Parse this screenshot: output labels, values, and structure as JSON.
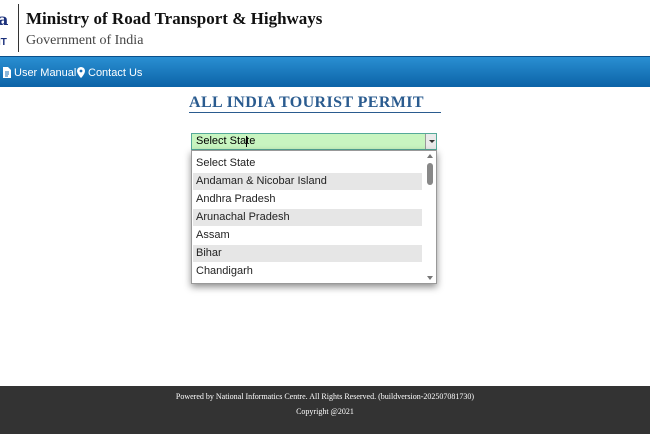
{
  "header": {
    "logo_text_top": "a",
    "logo_text_bottom": "IT",
    "title": "Ministry of Road Transport & Highways",
    "subtitle": "Government of India"
  },
  "nav": {
    "items": [
      {
        "label": "User Manual",
        "icon": "document-icon"
      },
      {
        "label": "Contact Us",
        "icon": "map-pin-icon"
      }
    ]
  },
  "main": {
    "heading": "ALL INDIA TOURIST PERMIT",
    "state_select": {
      "value": "Select State",
      "options": [
        "Select State",
        "Andaman & Nicobar Island",
        "Andhra Pradesh",
        "Arunachal Pradesh",
        "Assam",
        "Bihar",
        "Chandigarh"
      ]
    }
  },
  "footer": {
    "line1": "Powered by National Informatics Centre. All Rights Reserved. (buildversion-202507081730)",
    "line2": "Copyright @2021"
  },
  "colors": {
    "navbar": "#1a78c0",
    "heading": "#2a5b8f",
    "select_bg": "#c8f5c0",
    "footer": "#333333"
  }
}
